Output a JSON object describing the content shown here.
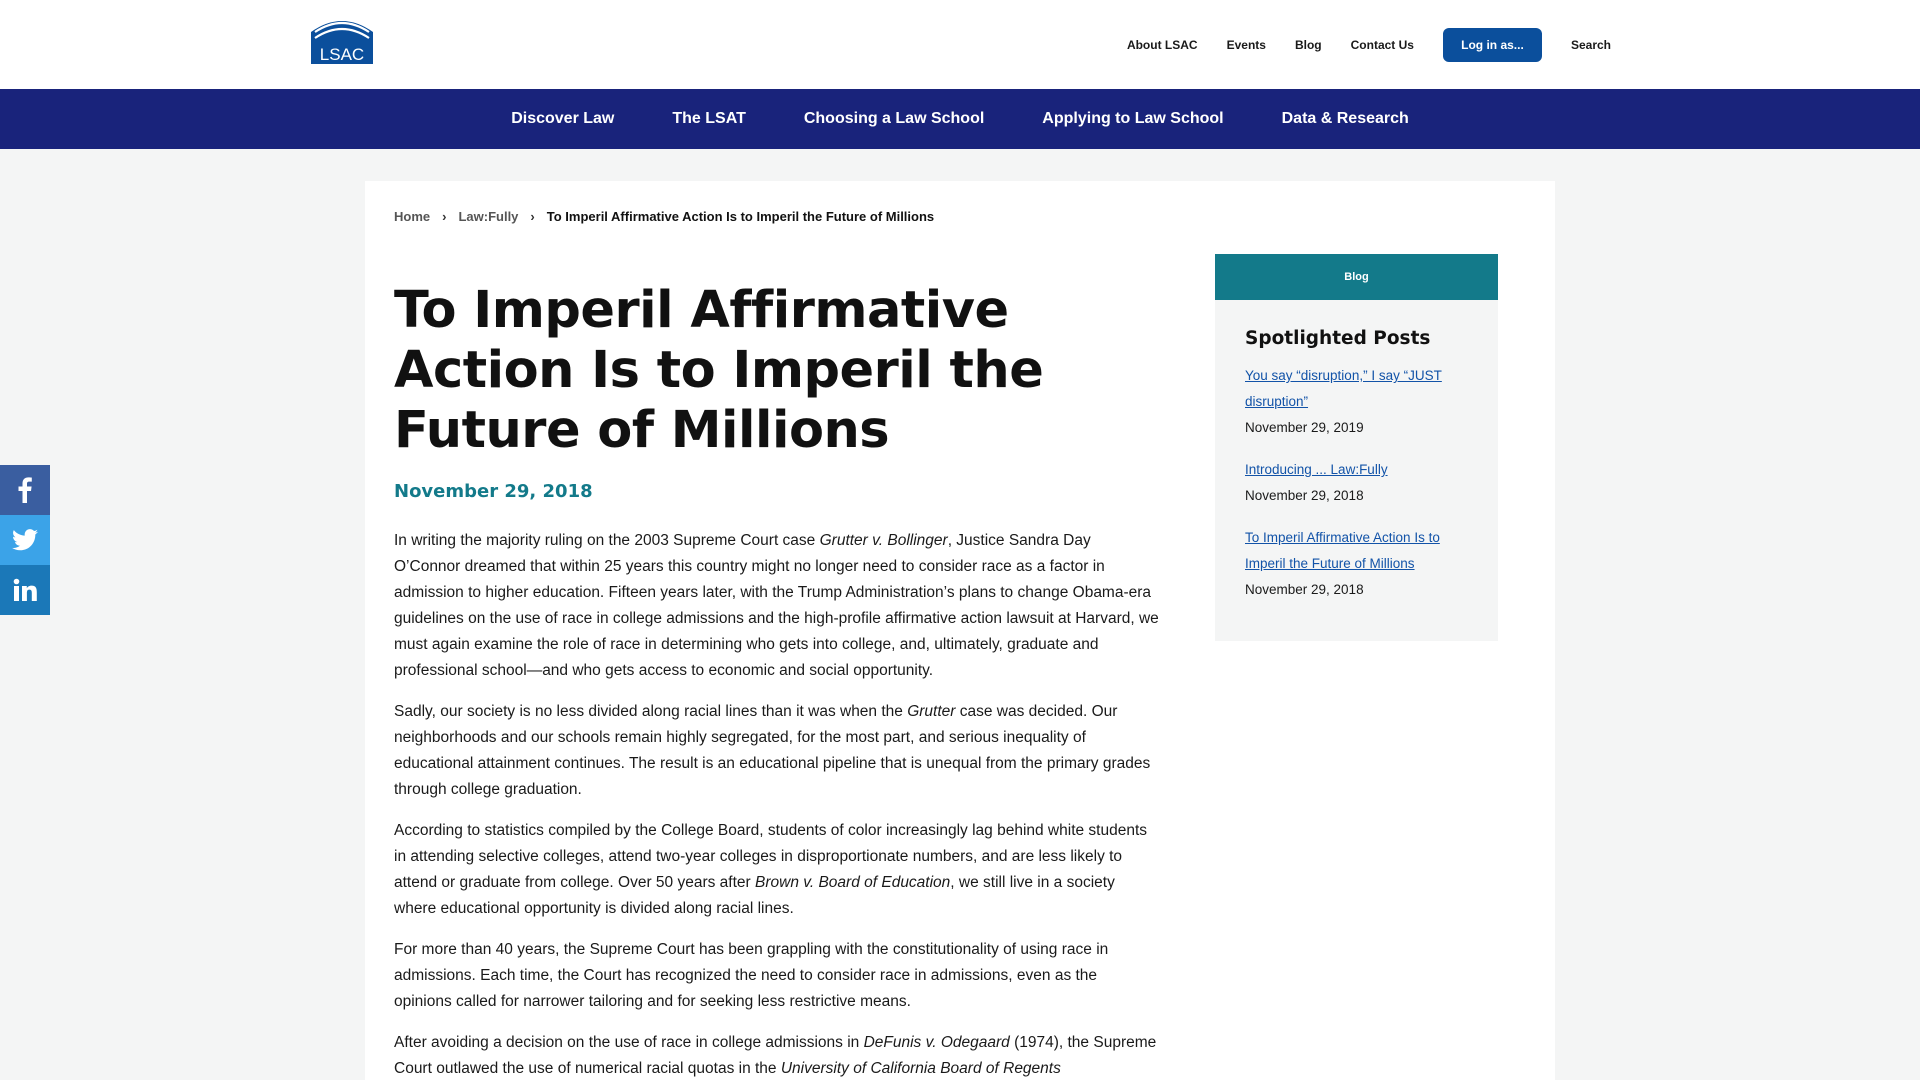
{
  "header": {
    "logo_text": "LSAC",
    "util_links": [
      "About LSAC",
      "Events",
      "Blog",
      "Contact Us"
    ],
    "login_label": "Log in as...",
    "search_label": "Search"
  },
  "main_nav": [
    "Discover Law",
    "The LSAT",
    "Choosing a Law School",
    "Applying to Law School",
    "Data & Research"
  ],
  "breadcrumb": {
    "home": "Home",
    "section": "Law:Fully",
    "current": "To Imperil Affirmative Action Is to Imperil the Future of Millions"
  },
  "article": {
    "title": "To Imperil Affirmative Action Is to Imperil the Future of Millions",
    "date": "November 29, 2018",
    "paragraphs": [
      [
        {
          "t": "In writing the majority ruling on the 2003 Supreme Court case "
        },
        {
          "t": "Grutter v. Bollinger",
          "i": true
        },
        {
          "t": ", Justice Sandra Day O’Connor dreamed that within 25 years this country might no longer need to consider race as a factor in admission to higher education. Fifteen years later, with the Trump Administration’s plans to change Obama-era guidelines on the use of race in college admissions and the high-profile affirmative action lawsuit at Harvard, we must again examine the role of race in determining who gets into college, and, ultimately, graduate and professional school—and who gets access to economic and social opportunity."
        }
      ],
      [
        {
          "t": "Sadly, our society is no less divided along racial lines than it was when the "
        },
        {
          "t": "Grutter",
          "i": true
        },
        {
          "t": " case was decided. Our neighborhoods and our schools remain highly segregated, for the most part, and serious inequality of educational attainment continues. The result is an educational pipeline that is unequal from the primary grades through college graduation."
        }
      ],
      [
        {
          "t": "According to statistics compiled by the College Board, students of color increasingly lag behind white students in attending selective colleges, attend two-year colleges in disproportionate numbers, and are less likely to attend or graduate from college. Over 50 years after "
        },
        {
          "t": "Brown v. Board of Education",
          "i": true
        },
        {
          "t": ", we still live in a society where educational opportunity is divided along racial lines."
        }
      ],
      [
        {
          "t": "For more than 40 years, the Supreme Court has been grappling with the constitutionality of using race in admissions. Each time, the Court has recognized the need to consider race in admissions, even as the opinions called for narrower tailoring and for seeking less restrictive means."
        }
      ],
      [
        {
          "t": "After avoiding a decision on the use of race in college admissions in "
        },
        {
          "t": "DeFunis v. Odegaard",
          "i": true
        },
        {
          "t": " (1974), the Supreme Court outlawed the use of numerical racial quotas in the "
        },
        {
          "t": "University of California Board of Regents",
          "i": true
        }
      ]
    ]
  },
  "sidebar": {
    "tab_label": "Blog",
    "heading": "Spotlighted Posts",
    "posts": [
      {
        "title": "You say “disruption,” I say “JUST disruption”",
        "date": "November 29, 2019"
      },
      {
        "title": "Introducing ... Law:Fully",
        "date": "November 29, 2018"
      },
      {
        "title": "To Imperil Affirmative Action Is to Imperil the Future of Millions",
        "date": "November 29, 2018"
      }
    ]
  },
  "share": {
    "icons": [
      "facebook-icon",
      "twitter-icon",
      "linkedin-icon"
    ],
    "colors": {
      "facebook": "#3a5ea0",
      "twitter": "#3ba3e8",
      "linkedin": "#1b78b8"
    }
  },
  "colors": {
    "nav_bg": "#19237b",
    "accent_teal": "#137a8a",
    "button_blue": "#0b4f9c",
    "link_blue": "#1253a8"
  }
}
